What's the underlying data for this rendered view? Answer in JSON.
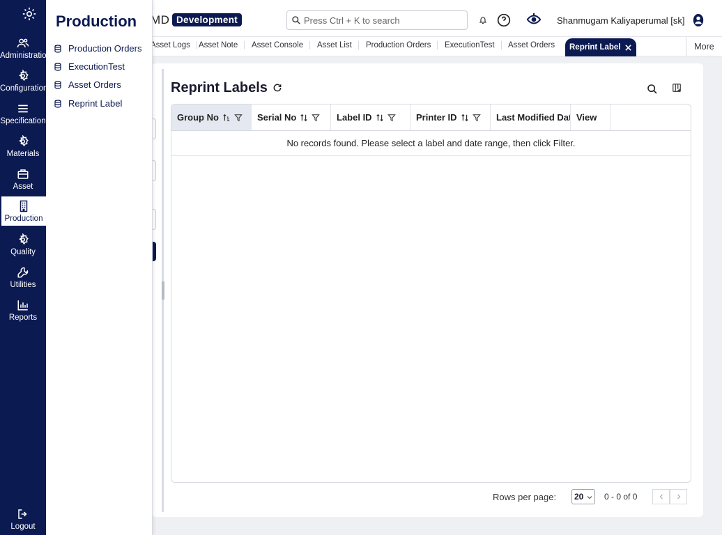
{
  "brand": {
    "name_fragment": "MD",
    "environment": "Development"
  },
  "header": {
    "search_placeholder": "Press Ctrl + K to search",
    "user_name": "Shanmugam Kaliyaperumal [sk]"
  },
  "rail": {
    "items": [
      {
        "label": "Administration",
        "icon": "users-icon"
      },
      {
        "label": "Configuration",
        "icon": "gear-icon"
      },
      {
        "label": "Specification",
        "icon": "list-icon"
      },
      {
        "label": "Materials",
        "icon": "gear-icon"
      },
      {
        "label": "Asset",
        "icon": "box-icon"
      },
      {
        "label": "Production",
        "icon": "building-icon",
        "active": true
      },
      {
        "label": "Quality",
        "icon": "gear-icon"
      },
      {
        "label": "Utilities",
        "icon": "wrench-icon"
      },
      {
        "label": "Reports",
        "icon": "bar-chart-icon"
      }
    ],
    "logout": "Logout"
  },
  "tabs": {
    "items": [
      "Asset Logs",
      "Asset Note",
      "Asset Console",
      "Asset List",
      "Production Orders",
      "ExecutionTest",
      "Asset Orders"
    ],
    "active": "Reprint Label",
    "more": "More"
  },
  "flyout": {
    "title": "Production",
    "items": [
      "Production Orders",
      "ExecutionTest",
      "Asset Orders",
      "Reprint Label"
    ]
  },
  "page": {
    "title": "Reprint Labels",
    "columns": [
      "Group No",
      "Serial No",
      "Label ID",
      "Printer ID",
      "Last Modified Date",
      "View"
    ],
    "empty_message": "No records found. Please select a label and date range, then click Filter."
  },
  "pagination": {
    "rows_label": "Rows per page:",
    "rows_value": "20",
    "range": "0 - 0 of 0"
  },
  "colors": {
    "navy": "#0c1a52",
    "background": "#eef0f4"
  }
}
